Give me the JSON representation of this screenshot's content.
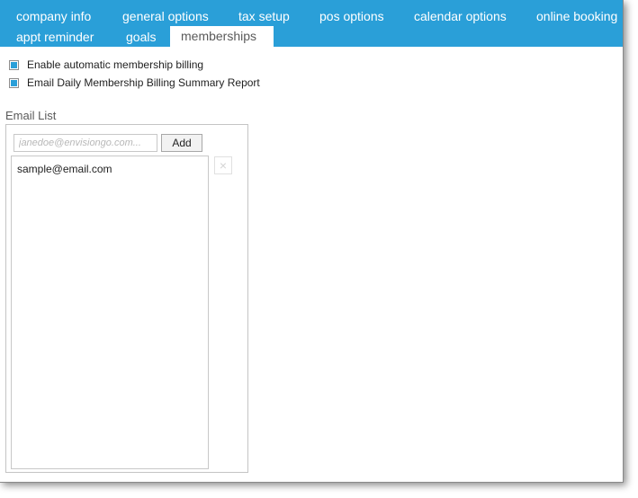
{
  "tabs": {
    "row1": [
      {
        "label": "company info"
      },
      {
        "label": "general options"
      },
      {
        "label": "tax setup"
      },
      {
        "label": "pos options"
      },
      {
        "label": "calendar options"
      },
      {
        "label": "online booking"
      }
    ],
    "row2": [
      {
        "label": "appt reminder"
      },
      {
        "label": "goals"
      },
      {
        "label": "memberships",
        "active": true
      }
    ]
  },
  "settings": {
    "auto_billing_label": "Enable automatic membership billing",
    "auto_billing_checked": true,
    "daily_report_label": "Email Daily Membership Billing Summary Report",
    "daily_report_checked": true
  },
  "email_list": {
    "label": "Email List",
    "input_placeholder": "janedoe@envisiongo.com...",
    "input_value": "",
    "add_label": "Add",
    "items": [
      "sample@email.com"
    ],
    "remove_icon": "×"
  },
  "colors": {
    "accent": "#2a9fd8",
    "active_tab_text": "#5a5a5a"
  }
}
